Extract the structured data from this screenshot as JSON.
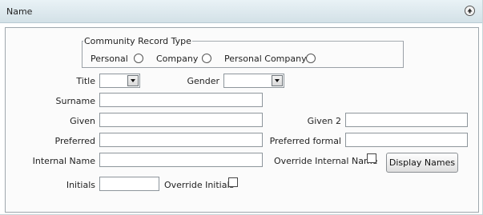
{
  "section": {
    "title": "Name",
    "collapse_icon": "chevron-up-circle-icon"
  },
  "record_type": {
    "legend": "Community Record Type",
    "options": [
      {
        "label": "Personal",
        "selected": false
      },
      {
        "label": "Company",
        "selected": false
      },
      {
        "label": "Personal Company",
        "selected": false
      }
    ]
  },
  "fields": {
    "title_label": "Title",
    "title_value": "",
    "gender_label": "Gender",
    "gender_value": "",
    "surname_label": "Surname",
    "surname_value": "",
    "given_label": "Given",
    "given_value": "",
    "given2_label": "Given 2",
    "given2_value": "",
    "preferred_label": "Preferred",
    "preferred_value": "",
    "preferred_formal_label": "Preferred formal",
    "preferred_formal_value": "",
    "internal_name_label": "Internal Name",
    "internal_name_value": "",
    "override_internal_label": "Override Internal Name",
    "override_internal_checked": false,
    "initials_label": "Initials",
    "initials_value": "",
    "override_initials_label": "Override Initials",
    "override_initials_checked": false
  },
  "buttons": {
    "display_names": "Display Names"
  }
}
